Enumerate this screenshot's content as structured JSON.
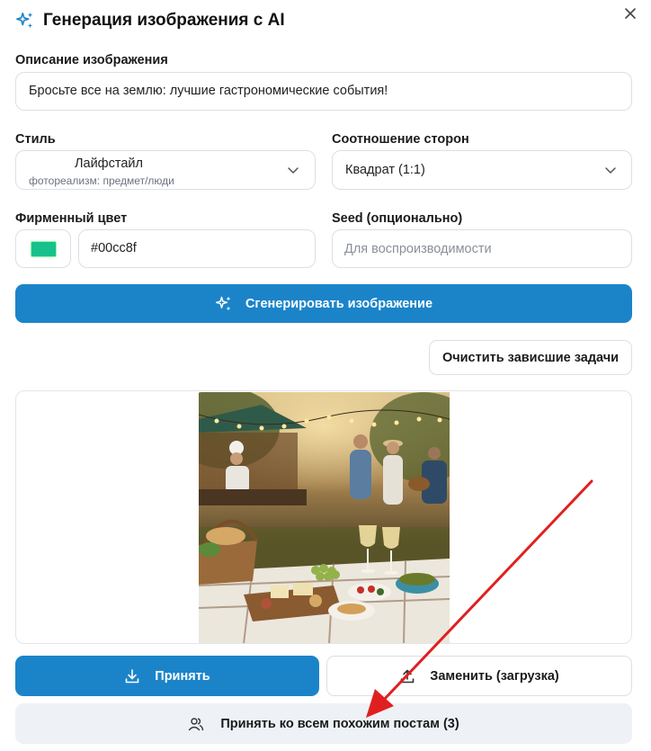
{
  "dialog": {
    "title": "Генерация изображения с AI"
  },
  "description": {
    "label": "Описание изображения",
    "value": "Бросьте все на землю: лучшие гастрономические события!"
  },
  "style": {
    "label": "Стиль",
    "value": "Лайфстайл",
    "subtitle": "фотореализм: предмет/люди"
  },
  "aspect": {
    "label": "Соотношение сторон",
    "value": "Квадрат (1:1)"
  },
  "brand_color": {
    "label": "Фирменный цвет",
    "value": "#00cc8f",
    "swatch": "#18c08c"
  },
  "seed": {
    "label": "Seed (опционально)",
    "placeholder": "Для воспроизводимости"
  },
  "actions": {
    "generate": "Сгенерировать изображение",
    "clear": "Очистить зависшие задачи",
    "accept": "Принять",
    "replace": "Заменить (загрузка)",
    "accept_all": "Принять ко всем похожим постам (3)"
  },
  "colors": {
    "primary": "#1b84c9",
    "annotation_arrow": "#e02020"
  }
}
